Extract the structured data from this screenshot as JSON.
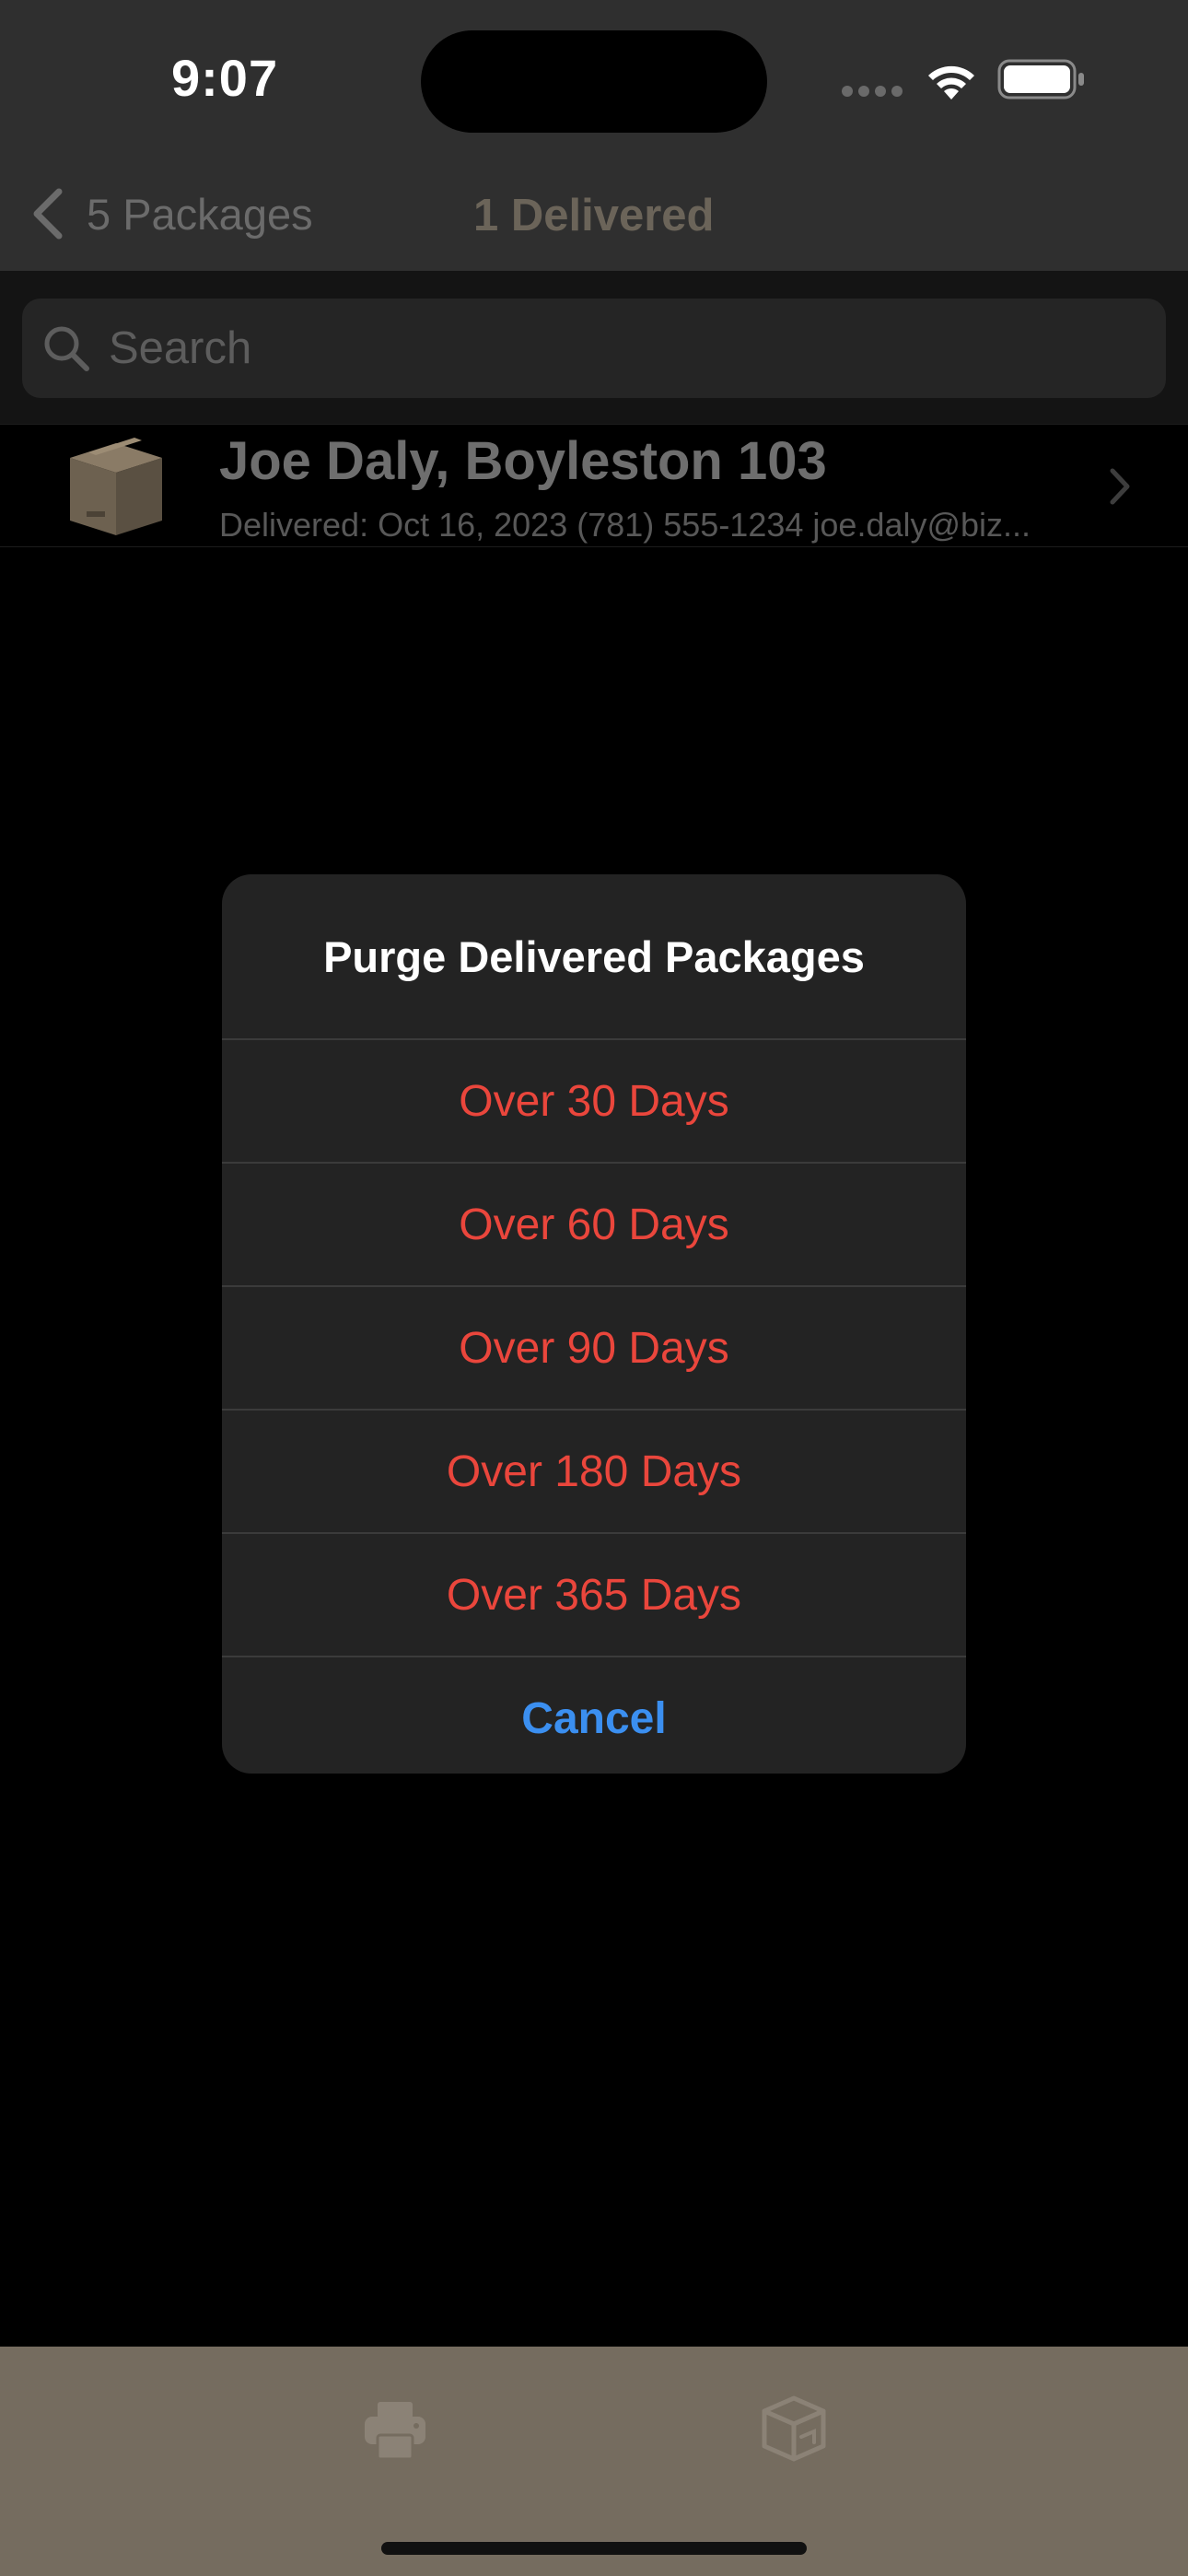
{
  "status_bar": {
    "time": "9:07"
  },
  "nav": {
    "back_label": "5 Packages",
    "title": "1 Delivered"
  },
  "search": {
    "placeholder": "Search"
  },
  "packages": [
    {
      "title": "Joe Daly, Boyleston 103",
      "subtitle": "Delivered: Oct 16, 2023 (781) 555-1234 joe.daly@biz..."
    }
  ],
  "alert": {
    "title": "Purge Delivered Packages",
    "actions": [
      "Over 30 Days",
      "Over 60 Days",
      "Over 90 Days",
      "Over 180 Days",
      "Over 365 Days"
    ],
    "cancel_label": "Cancel"
  },
  "colors": {
    "destructive": "#ea463c",
    "cancel": "#3b8ff0",
    "toolbar": "#756c5f"
  },
  "icons": {
    "back": "chevron-left-icon",
    "search": "magnifying-glass-icon",
    "row_thumb": "package-box-icon",
    "row_disclosure": "chevron-right-icon",
    "toolbar_left": "printer-icon",
    "toolbar_right": "open-box-icon"
  }
}
